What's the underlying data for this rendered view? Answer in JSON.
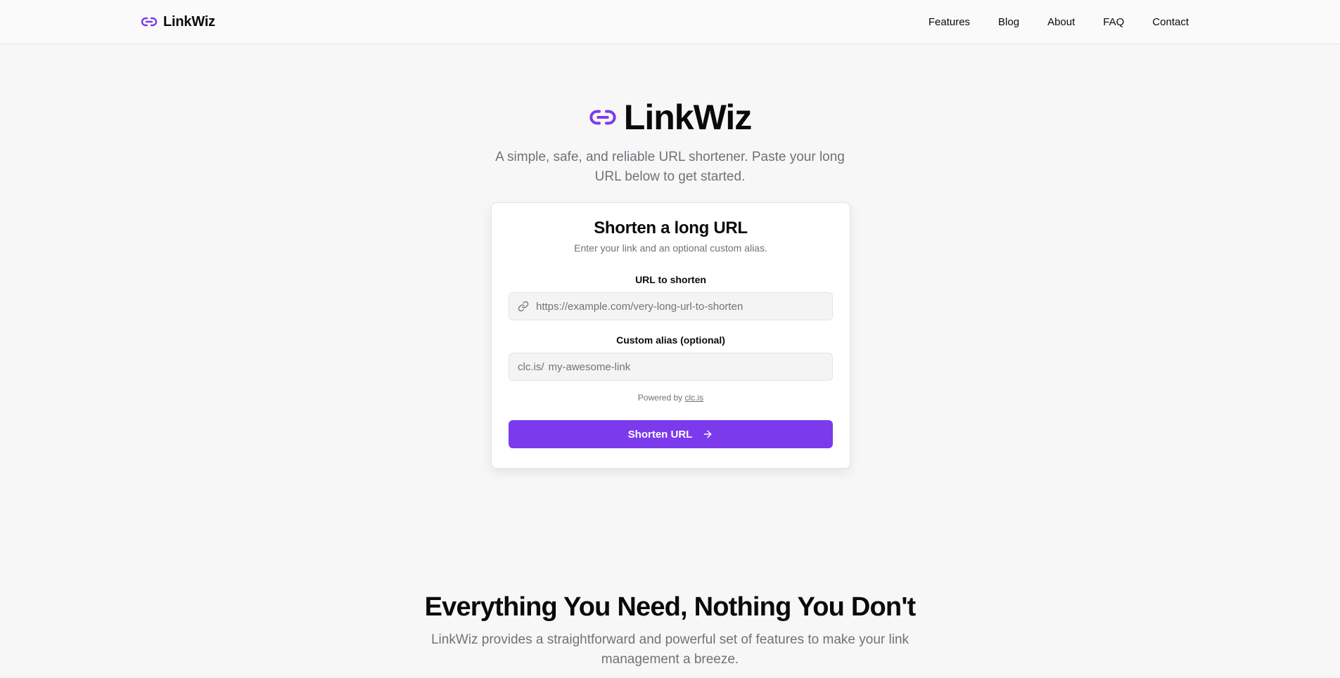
{
  "nav": {
    "brand": "LinkWiz",
    "brand_icon": "link-icon",
    "links": [
      "Features",
      "Blog",
      "About",
      "FAQ",
      "Contact"
    ]
  },
  "hero": {
    "title": "LinkWiz",
    "subtitle": "A simple, safe, and reliable URL shortener. Paste your long URL below to get started."
  },
  "card": {
    "title": "Shorten a long URL",
    "description": "Enter your link and an optional custom alias.",
    "url_label": "URL to shorten",
    "url_placeholder": "https://example.com/very-long-url-to-shorten",
    "alias_label": "Custom alias (optional)",
    "alias_prefix": "clc.is/",
    "alias_placeholder": "my-awesome-link",
    "powered_text": "Powered by",
    "powered_link": "clc.is",
    "submit_label": "Shorten URL"
  },
  "features": {
    "title": "Everything You Need, Nothing You Don't",
    "subtitle": "LinkWiz provides a straightforward and powerful set of features to make your link management a breeze."
  },
  "colors": {
    "accent": "#7c3aed",
    "muted_text": "#71717a",
    "background": "#f7f7f7"
  }
}
